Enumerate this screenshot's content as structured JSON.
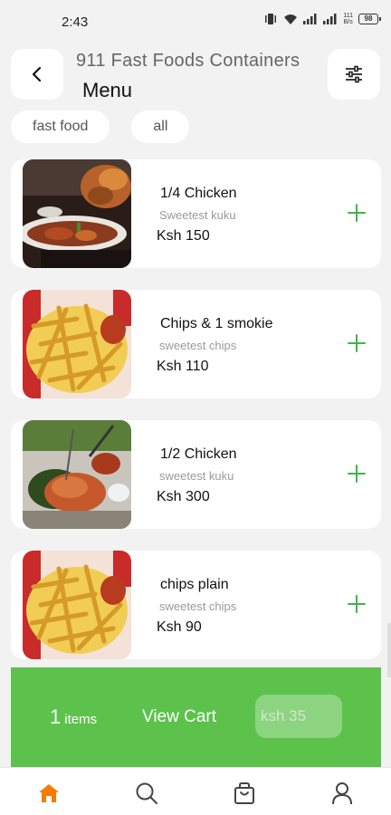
{
  "status": {
    "time": "2:43",
    "net_speed_top": "111",
    "net_speed_unit": "B/s",
    "battery": "98"
  },
  "header": {
    "store_name": "911 Fast Foods Containers",
    "title": "Menu",
    "back_icon": "back-chevron-icon",
    "filter_icon": "sliders-icon"
  },
  "filters": [
    {
      "label": "fast food"
    },
    {
      "label": "all"
    }
  ],
  "items": [
    {
      "name": "1/4 Chicken",
      "desc": "Sweetest kuku",
      "price": "Ksh 150",
      "image": "roast-chicken"
    },
    {
      "name": "Chips & 1 smokie",
      "desc": "sweetest chips",
      "price": "Ksh 110",
      "image": "fries"
    },
    {
      "name": "1/2 Chicken",
      "desc": "sweetest kuku",
      "price": "Ksh 300",
      "image": "grilled-chicken"
    },
    {
      "name": "chips plain",
      "desc": "sweetest chips",
      "price": "Ksh 90",
      "image": "fries"
    }
  ],
  "cart": {
    "count": "1",
    "count_label": "items",
    "view_label": "View Cart",
    "total": "ksh 35",
    "color": "#5cc24b"
  },
  "nav": {
    "active_color": "#f57c00",
    "items": [
      "home-icon",
      "search-icon",
      "bag-icon",
      "profile-icon"
    ]
  }
}
